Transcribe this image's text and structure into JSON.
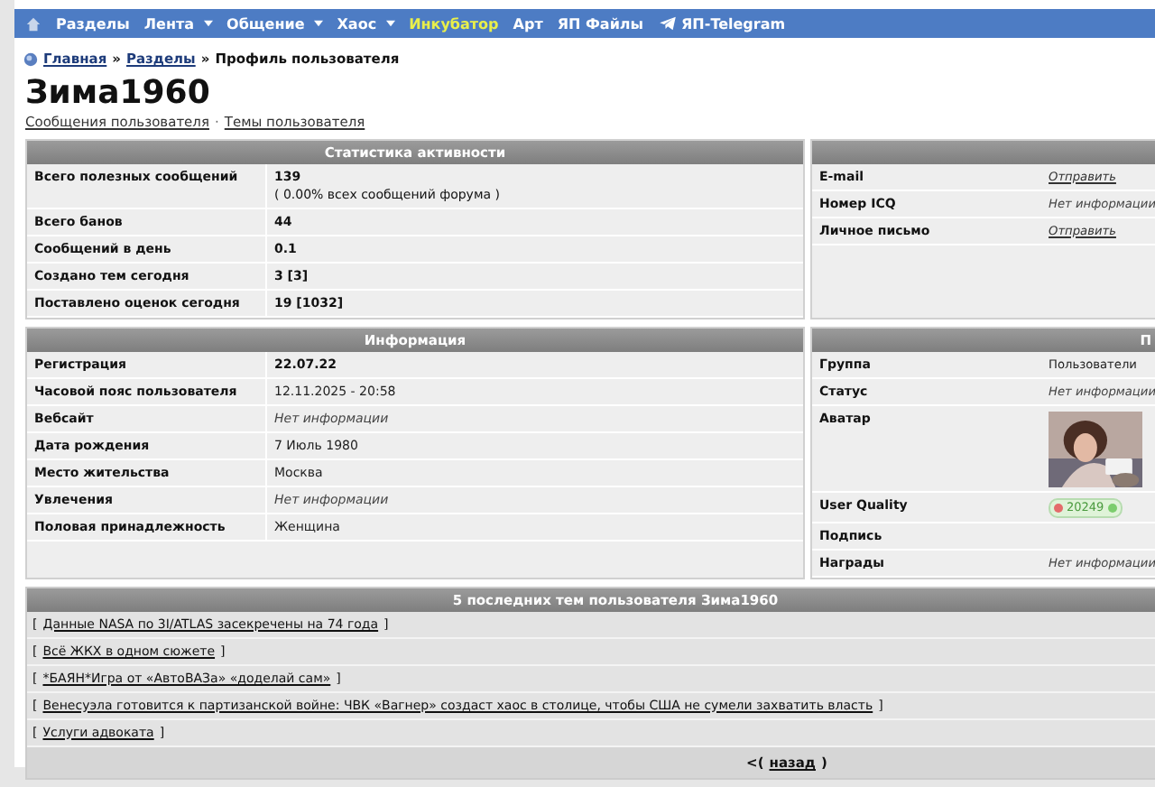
{
  "nav": [
    {
      "kind": "home"
    },
    {
      "kind": "link",
      "label": "Разделы",
      "dropdown": false,
      "highlight": false
    },
    {
      "kind": "link",
      "label": "Лента",
      "dropdown": true,
      "highlight": false
    },
    {
      "kind": "link",
      "label": "Общение",
      "dropdown": true,
      "highlight": false
    },
    {
      "kind": "link",
      "label": "Хаос",
      "dropdown": true,
      "highlight": false
    },
    {
      "kind": "link",
      "label": "Инкубатор",
      "dropdown": false,
      "highlight": true
    },
    {
      "kind": "link",
      "label": "Арт",
      "dropdown": false,
      "highlight": false
    },
    {
      "kind": "link",
      "label": "ЯП Файлы",
      "dropdown": false,
      "highlight": false
    },
    {
      "kind": "telegram",
      "label": "ЯП-Telegram",
      "dropdown": false,
      "highlight": false
    }
  ],
  "breadcrumb": {
    "links": [
      "Главная",
      "Разделы"
    ],
    "current": "Профиль пользователя",
    "separator": "»"
  },
  "profile": {
    "name": "Зима1960",
    "links": [
      "Сообщения пользователя",
      "Темы пользователя"
    ],
    "link_separator": "·"
  },
  "stats": {
    "title": "Статистика активности",
    "rows": [
      {
        "label": "Всего полезных сообщений",
        "value": "139",
        "note": "( 0.00% всех сообщений форума )",
        "kind": "bold"
      },
      {
        "label": "Всего банов",
        "value": "44",
        "kind": "bold"
      },
      {
        "label": "Сообщений в день",
        "value": "0.1",
        "kind": "bold"
      },
      {
        "label": "Создано тем сегодня",
        "value": "3 [3]",
        "kind": "bold"
      },
      {
        "label": "Поставлено оценок сегодня",
        "value": "19 [1032]",
        "kind": "bold"
      }
    ]
  },
  "contact": {
    "rows": [
      {
        "label": "E-mail",
        "value": "Отправить",
        "kind": "link"
      },
      {
        "label": "Номер ICQ",
        "value": "Нет информации",
        "kind": "italic"
      },
      {
        "label": "Личное письмо",
        "value": "Отправить",
        "kind": "link"
      }
    ]
  },
  "info": {
    "title": "Информация",
    "rows": [
      {
        "label": "Регистрация",
        "value": "22.07.22",
        "kind": "bold"
      },
      {
        "label": "Часовой пояс пользователя",
        "value": "12.11.2025 - 20:58",
        "kind": "plain"
      },
      {
        "label": "Вебсайт",
        "value": "Нет информации",
        "kind": "italic"
      },
      {
        "label": "Дата рождения",
        "value": "7 Июль 1980",
        "kind": "plain"
      },
      {
        "label": "Место жительства",
        "value": "Москва",
        "kind": "plain"
      },
      {
        "label": "Увлечения",
        "value": "Нет информации",
        "kind": "italic"
      },
      {
        "label": "Половая принадлежность",
        "value": "Женщина",
        "kind": "plain"
      }
    ]
  },
  "personal": {
    "title": "П",
    "rows": [
      {
        "label": "Группа",
        "value": "Пользователи",
        "kind": "plain"
      },
      {
        "label": "Статус",
        "value": "Нет информации",
        "kind": "italic"
      },
      {
        "label": "Аватар",
        "kind": "avatar"
      },
      {
        "label": "User Quality",
        "value": "20249",
        "kind": "badge"
      },
      {
        "label": "Подпись",
        "kind": "empty"
      },
      {
        "label": "Награды",
        "value": "Нет информации",
        "kind": "italic"
      }
    ]
  },
  "topics": {
    "title": "5 последних тем пользователя Зима1960",
    "items": [
      "Данные NASA по 3I/ATLAS засекречены на 74 года",
      "Всё ЖКХ в одном сюжете",
      "*БАЯН*Игра от «АвтоВАЗа» «доделай сам»",
      "Венесуэла готовится к партизанской войне: ЧВК «Вагнер» создаст хаос в столице, чтобы США не сумели захватить власть",
      "Услуги адвоката"
    ],
    "open": "[",
    "close": "]"
  },
  "back": {
    "prefix": "<(",
    "label": "назад",
    "suffix": ")"
  }
}
